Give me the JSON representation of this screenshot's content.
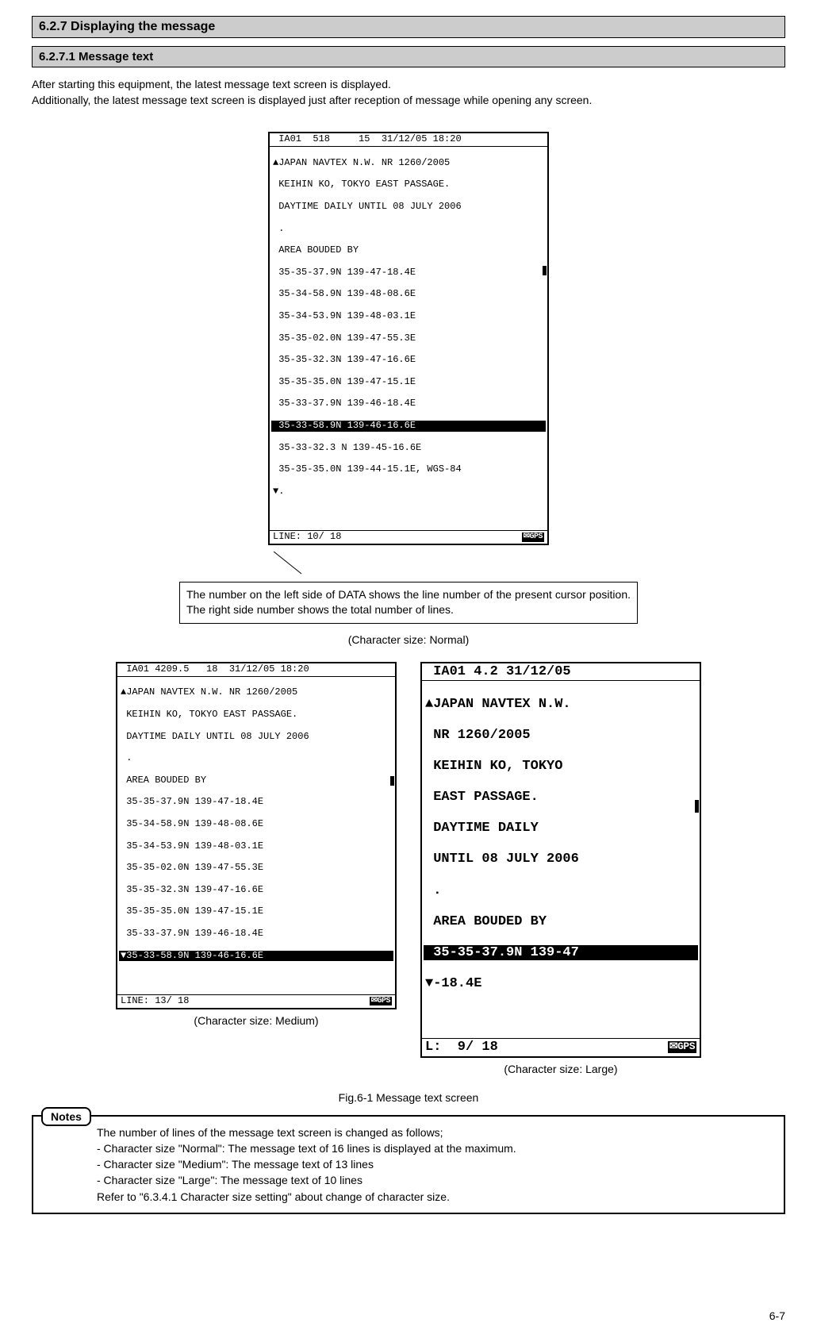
{
  "section": {
    "title": "6.2.7 Displaying the message"
  },
  "subsection": {
    "title": "6.2.7.1 Message text"
  },
  "intro": {
    "line1": "After starting this equipment, the latest message text screen is displayed.",
    "line2": "Additionally, the latest message text screen is displayed just after reception of message while opening any screen."
  },
  "screens": {
    "normal": {
      "header": " IA01  518     15  31/12/05 18:20",
      "lines": [
        "▲JAPAN NAVTEX N.W. NR 1260/2005",
        " KEIHIN KO, TOKYO EAST PASSAGE.",
        " DAYTIME DAILY UNTIL 08 JULY 2006",
        " .",
        " AREA BOUDED BY",
        " 35-35-37.9N 139-47-18.4E",
        " 35-34-58.9N 139-48-08.6E",
        " 35-34-53.9N 139-48-03.1E",
        " 35-35-02.0N 139-47-55.3E",
        " 35-35-32.3N 139-47-16.6E",
        " 35-35-35.0N 139-47-15.1E",
        " 35-33-37.9N 139-46-18.4E"
      ],
      "highlight": " 35-33-58.9N 139-46-16.6E",
      "after_highlight": [
        " 35-33-32.3 N 139-45-16.6E",
        " 35-35-35.0N 139-44-15.1E, WGS-84",
        "▼."
      ],
      "footer": "LINE: 10/ 18",
      "icons": "✉GPS"
    },
    "medium": {
      "header": " IA01 4209.5   18  31/12/05 18:20",
      "lines": [
        "▲JAPAN NAVTEX N.W. NR 1260/2005",
        " KEIHIN KO, TOKYO EAST PASSAGE.",
        " DAYTIME DAILY UNTIL 08 JULY 2006",
        " .",
        " AREA BOUDED BY",
        " 35-35-37.9N 139-47-18.4E",
        " 35-34-58.9N 139-48-08.6E",
        " 35-34-53.9N 139-48-03.1E",
        " 35-35-02.0N 139-47-55.3E",
        " 35-35-32.3N 139-47-16.6E",
        " 35-35-35.0N 139-47-15.1E",
        " 35-33-37.9N 139-46-18.4E"
      ],
      "highlight": "▼35-33-58.9N 139-46-16.6E",
      "footer": "LINE: 13/ 18",
      "icons": "✉GPS"
    },
    "large": {
      "header": " IA01 4.2 31/12/05",
      "lines": [
        "▲JAPAN NAVTEX N.W.",
        " NR 1260/2005",
        " KEIHIN KO, TOKYO",
        " EAST PASSAGE.",
        " DAYTIME DAILY",
        " UNTIL 08 JULY 2006",
        " .",
        " AREA BOUDED BY"
      ],
      "highlight": " 35-35-37.9N 139-47",
      "after_highlight": [
        "▼-18.4E"
      ],
      "footer": "L:  9/ 18",
      "icons": "✉GPS"
    }
  },
  "callout": {
    "text": "The number on the left side of DATA shows the line number of the present cursor position. The right side number shows the total number of lines."
  },
  "captions": {
    "normal": "(Character size: Normal)",
    "medium": "(Character size: Medium)",
    "large": "(Character size: Large)",
    "figure": "Fig.6-1 Message text screen"
  },
  "notes": {
    "label": "Notes",
    "intro": "The number of lines of the message text screen is changed as follows;",
    "item1": "- Character size \"Normal\":     The message text of 16 lines is displayed at the maximum.",
    "item2": "- Character size \"Medium\":    The message text of 13 lines",
    "item3": "- Character size \"Large\":        The message text of 10 lines",
    "refer": "Refer to \"6.3.4.1 Character size setting\" about change of character size."
  },
  "page_number": "6-7"
}
